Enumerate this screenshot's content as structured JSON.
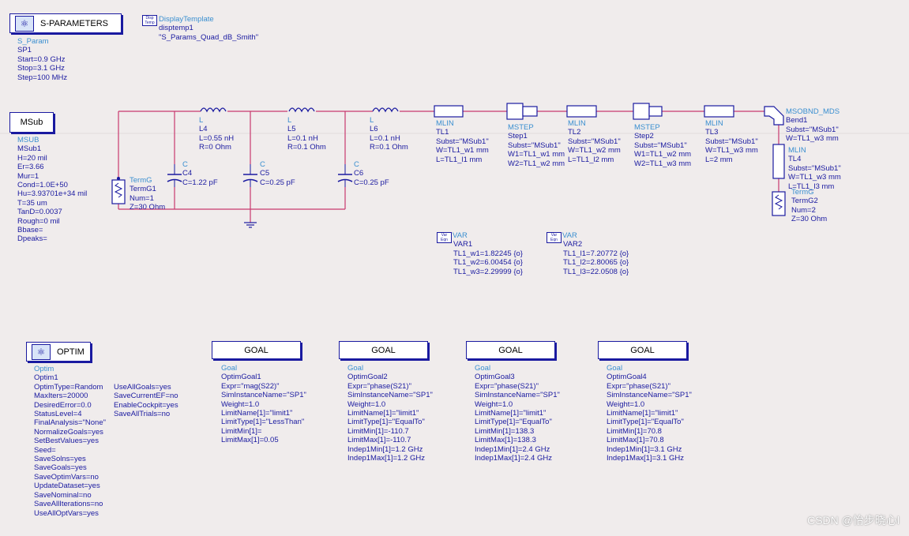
{
  "sparam_block": {
    "button_label": "S-PARAMETERS",
    "lines": [
      "S_Param",
      "SP1",
      "Start=0.9 GHz",
      "Stop=3.1 GHz",
      "Step=100 MHz"
    ]
  },
  "display_template": {
    "icon_text": "Disp Temp",
    "lines": [
      "DisplayTemplate",
      "disptemp1",
      "\"S_Params_Quad_dB_Smith\""
    ]
  },
  "msub_block": {
    "button_label": "MSub",
    "lines": [
      "MSUB",
      "MSub1",
      "H=20 mil",
      "Er=3.66",
      "Mur=1",
      "Cond=1.0E+50",
      "Hu=3.93701e+34 mil",
      "T=35 um",
      "TanD=0.0037",
      "Rough=0 mil",
      "Bbase=",
      "Dpeaks="
    ]
  },
  "components": {
    "termg1": [
      "TermG",
      "TermG1",
      "Num=1",
      "Z=30 Ohm"
    ],
    "l4": [
      "L",
      "L4",
      "L=0.55 nH",
      "R=0 Ohm"
    ],
    "l5": [
      "L",
      "L5",
      "L=0.1 nH",
      "R=0.1 Ohm"
    ],
    "l6": [
      "L",
      "L6",
      "L=0.1 nH",
      "R=0.1 Ohm"
    ],
    "c4": [
      "C",
      "C4",
      "C=1.22 pF"
    ],
    "c5": [
      "C",
      "C5",
      "C=0.25 pF"
    ],
    "c6": [
      "C",
      "C6",
      "C=0.25 pF"
    ],
    "tl1": [
      "MLIN",
      "TL1",
      "Subst=\"MSub1\"",
      "W=TL1_w1 mm",
      "L=TL1_l1 mm"
    ],
    "step1": [
      "MSTEP",
      "Step1",
      "Subst=\"MSub1\"",
      "W1=TL1_w1 mm",
      "W2=TL1_w2 mm"
    ],
    "tl2": [
      "MLIN",
      "TL2",
      "Subst=\"MSub1\"",
      "W=TL1_w2 mm",
      "L=TL1_l2 mm"
    ],
    "step2": [
      "MSTEP",
      "Step2",
      "Subst=\"MSub1\"",
      "W1=TL1_w2 mm",
      "W2=TL1_w3 mm"
    ],
    "tl3": [
      "MLIN",
      "TL3",
      "Subst=\"MSub1\"",
      "W=TL1_w3 mm",
      "L=2 mm"
    ],
    "bend1": [
      "MSOBND_MDS",
      "Bend1",
      "Subst=\"MSub1\"",
      "W=TL1_w3 mm"
    ],
    "tl4": [
      "MLIN",
      "TL4",
      "Subst=\"MSub1\"",
      "W=TL1_w3 mm",
      "L=TL1_l3 mm"
    ],
    "termg2": [
      "TermG",
      "TermG2",
      "Num=2",
      "Z=30 Ohm"
    ]
  },
  "vars": {
    "icon_text": "Var Eqn",
    "var1": [
      "VAR",
      "VAR1",
      "TL1_w1=1.82245 {o}",
      "TL1_w2=6.00454 {o}",
      "TL1_w3=2.29999 {o}"
    ],
    "var2": [
      "VAR",
      "VAR2",
      "TL1_l1=7.20772 {o}",
      "TL1_l2=2.80065 {o}",
      "TL1_l3=22.0508 {o}"
    ]
  },
  "optim": {
    "button_label": "OPTIM",
    "col1": [
      "Optim",
      "Optim1",
      "OptimType=Random",
      "MaxIters=20000",
      "DesiredError=0.0",
      "StatusLevel=4",
      "FinalAnalysis=\"None\"",
      "NormalizeGoals=yes",
      "SetBestValues=yes",
      "Seed=",
      "SaveSolns=yes",
      "SaveGoals=yes",
      "SaveOptimVars=no",
      "UpdateDataset=yes",
      "SaveNominal=no",
      "SaveAllIterations=no",
      "UseAllOptVars=yes"
    ],
    "col2": [
      "UseAllGoals=yes",
      "SaveCurrentEF=no",
      "EnableCockpit=yes",
      "SaveAllTrials=no"
    ]
  },
  "goals": [
    {
      "button_label": "GOAL",
      "lines": [
        "Goal",
        "OptimGoal1",
        "Expr=\"mag(S22)\"",
        "SimInstanceName=\"SP1\"",
        "Weight=1.0",
        "LimitName[1]=\"limit1\"",
        "LimitType[1]=\"LessThan\"",
        "LimitMin[1]=",
        "LimitMax[1]=0.05"
      ]
    },
    {
      "button_label": "GOAL",
      "lines": [
        "Goal",
        "OptimGoal2",
        "Expr=\"phase(S21)\"",
        "SimInstanceName=\"SP1\"",
        "Weight=1.0",
        "LimitName[1]=\"limit1\"",
        "LimitType[1]=\"EqualTo\"",
        "LimitMin[1]=-110.7",
        "LimitMax[1]=-110.7",
        "Indep1Min[1]=1.2 GHz",
        "Indep1Max[1]=1.2 GHz"
      ]
    },
    {
      "button_label": "GOAL",
      "lines": [
        "Goal",
        "OptimGoal3",
        "Expr=\"phase(S21)\"",
        "SimInstanceName=\"SP1\"",
        "Weight=1.0",
        "LimitName[1]=\"limit1\"",
        "LimitType[1]=\"EqualTo\"",
        "LimitMin[1]=138.3",
        "LimitMax[1]=138.3",
        "Indep1Min[1]=2.4 GHz",
        "Indep1Max[1]=2.4 GHz"
      ]
    },
    {
      "button_label": "GOAL",
      "lines": [
        "Goal",
        "OptimGoal4",
        "Expr=\"phase(S21)\"",
        "SimInstanceName=\"SP1\"",
        "Weight=1.0",
        "LimitName[1]=\"limit1\"",
        "LimitType[1]=\"EqualTo\"",
        "LimitMin[1]=70.8",
        "LimitMax[1]=70.8",
        "Indep1Min[1]=3.1 GHz",
        "Indep1Max[1]=3.1 GHz"
      ]
    }
  ],
  "watermark": "CSDN @怡步晓心l",
  "colors": {
    "background": "#f0ecec",
    "wire": "#c8386e",
    "component": "#1a1aa0",
    "label": "#1a1aa0",
    "type_label": "#3a8fd0"
  }
}
